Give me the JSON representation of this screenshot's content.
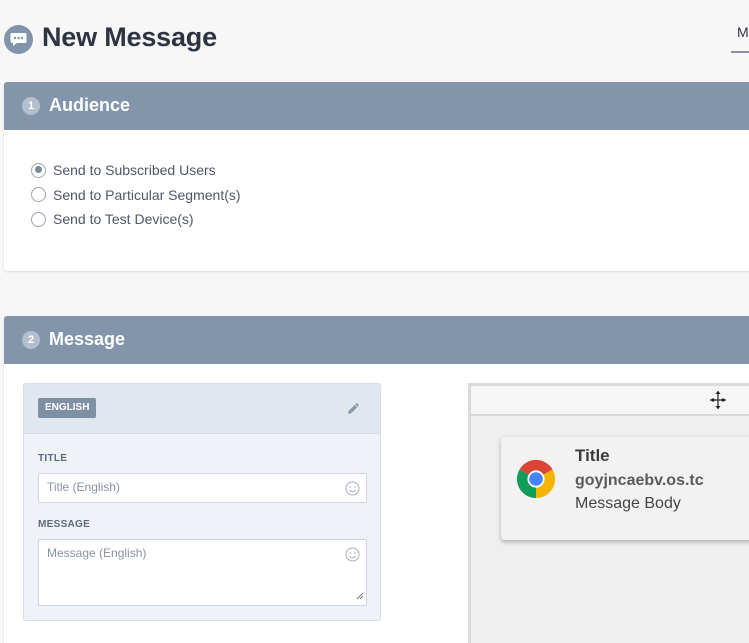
{
  "header": {
    "title": "New Message",
    "tab_label": "M"
  },
  "audience": {
    "step": "1",
    "title": "Audience",
    "options": [
      {
        "label": "Send to Subscribed Users",
        "selected": true
      },
      {
        "label": "Send to Particular Segment(s)",
        "selected": false
      },
      {
        "label": "Send to Test Device(s)",
        "selected": false
      }
    ]
  },
  "message": {
    "step": "2",
    "title": "Message",
    "language_badge": "ENGLISH",
    "title_label": "TITLE",
    "title_placeholder": "Title (English)",
    "message_label": "MESSAGE",
    "message_placeholder": "Message (English)"
  },
  "preview": {
    "title": "Title",
    "site": "goyjncaebv.os.tc",
    "body": "Message Body",
    "more_glyph": "⋮"
  },
  "colors": {
    "section_header": "#8395ab",
    "accent": "#8294ab",
    "badge": "#7f8fa4"
  },
  "icons": {
    "header": "message-bubble-icon",
    "edit": "pencil-icon",
    "emoji": "smiley-icon",
    "browser": "chrome-icon"
  }
}
